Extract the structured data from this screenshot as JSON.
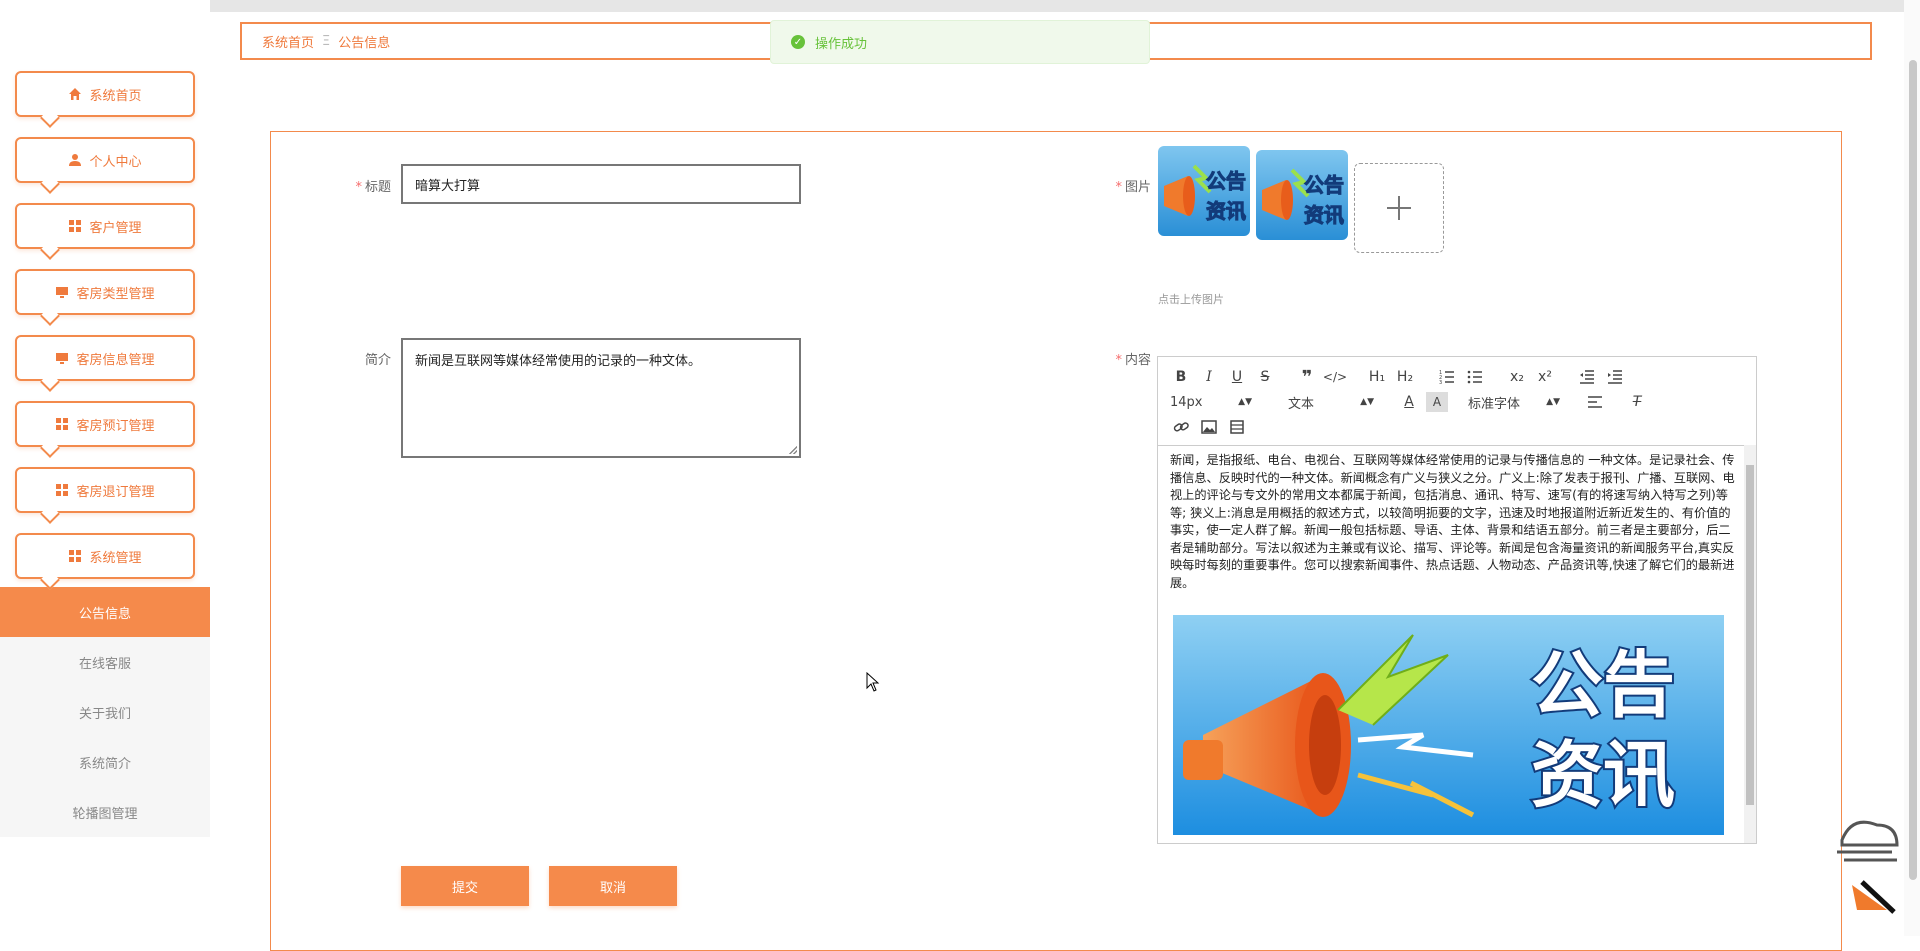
{
  "sidebar": {
    "items": [
      {
        "label": "系统首页",
        "icon": "home-icon"
      },
      {
        "label": "个人中心",
        "icon": "user-icon"
      },
      {
        "label": "客户管理",
        "icon": "grid-icon"
      },
      {
        "label": "客房类型管理",
        "icon": "monitor-icon"
      },
      {
        "label": "客房信息管理",
        "icon": "monitor-icon"
      },
      {
        "label": "客房预订管理",
        "icon": "grid-icon"
      },
      {
        "label": "客房退订管理",
        "icon": "grid-icon"
      },
      {
        "label": "系统管理",
        "icon": "grid-icon"
      }
    ],
    "sub_items": [
      {
        "label": "公告信息",
        "active": true
      },
      {
        "label": "在线客服",
        "active": false
      },
      {
        "label": "关于我们",
        "active": false
      },
      {
        "label": "系统简介",
        "active": false
      },
      {
        "label": "轮播图管理",
        "active": false
      }
    ]
  },
  "breadcrumb": {
    "home": "系统首页",
    "separator": "Ξ",
    "current": "公告信息"
  },
  "toast": {
    "message": "操作成功",
    "icon": "check-circle-icon"
  },
  "form": {
    "title": {
      "label": "标题",
      "value": "暗算大打算"
    },
    "intro": {
      "label": "简介",
      "value": "新闻是互联网等媒体经常使用的记录的一种文体。"
    },
    "image": {
      "label": "图片",
      "upload_tip": "点击上传图片",
      "thumb_text": [
        "公告",
        "资讯"
      ]
    },
    "content": {
      "label": "内容",
      "toolbar": {
        "font_size": "14px",
        "block_type": "文本",
        "font_family": "标准字体",
        "sub": "x₂",
        "sup": "x²",
        "h1": "H₁",
        "h2": "H₂"
      },
      "body": "新闻，是指报纸、电台、电视台、互联网等媒体经常使用的记录与传播信息的 一种文体。是记录社会、传播信息、反映时代的一种文体。新闻概念有广义与狭义之分。广义上:除了发表于报刊、广播、互联网、电视上的评论与专文外的常用文本都属于新闻，包括消息、通讯、特写、速写(有的将速写纳入特写之列)等等; 狭义上:消息是用概括的叙述方式，以较简明扼要的文字，迅速及时地报道附近新近发生的、有价值的事实，使一定人群了解。新闻一般包括标题、导语、主体、背景和结语五部分。前三者是主要部分，后二者是辅助部分。写法以叙述为主兼或有议论、描写、评论等。新闻是包含海量资讯的新闻服务平台,真实反映每时每刻的重要事件。您可以搜索新闻事件、热点话题、人物动态、产品资讯等,快速了解它们的最新进展。",
      "banner_text": [
        "公告",
        "资讯"
      ]
    },
    "submit_label": "提交",
    "cancel_label": "取消"
  },
  "colors": {
    "accent": "#f58a4b",
    "border": "#f38a4c",
    "success": "#67c23a"
  }
}
